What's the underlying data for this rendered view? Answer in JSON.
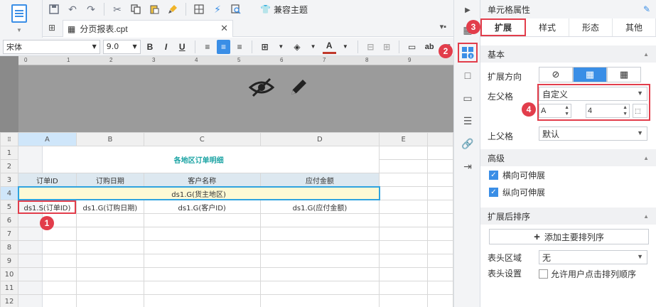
{
  "toolbar": {
    "compat_label": "兼容主题"
  },
  "tab": {
    "filename": "分页报表.cpt"
  },
  "format": {
    "font": "宋体",
    "size": "9.0",
    "bold": "B",
    "italic": "I",
    "underline": "U",
    "color_letter": "A",
    "ab": "ab"
  },
  "ruler": [
    "0",
    "1",
    "2",
    "3",
    "4",
    "5",
    "6",
    "7",
    "8",
    "9"
  ],
  "sheet": {
    "columns": [
      "A",
      "B",
      "C",
      "D",
      "E"
    ],
    "rows": [
      "1",
      "2",
      "3",
      "4",
      "5",
      "6",
      "7",
      "8",
      "9",
      "10",
      "11",
      "12"
    ],
    "title": "各地区订单明细",
    "headers": [
      "订单ID",
      "订购日期",
      "客户名称",
      "应付金额"
    ],
    "row4": "ds1.G(货主地区)",
    "row5": [
      "ds1.S(订单ID)",
      "ds1.G(订购日期)",
      "ds1.G(客户ID)",
      "ds1.G(应付金额)"
    ]
  },
  "markers": [
    "1",
    "2",
    "3",
    "4"
  ],
  "panel": {
    "title": "单元格属性",
    "tabs": [
      "扩展",
      "样式",
      "形态",
      "其他"
    ],
    "basic": "基本",
    "direction_label": "扩展方向",
    "left_parent_label": "左父格",
    "left_parent_value": "自定义",
    "left_col": "A",
    "left_row": "4",
    "top_parent_label": "上父格",
    "top_parent_value": "默认",
    "advanced": "高级",
    "h_extend": "横向可伸展",
    "v_extend": "纵向可伸展",
    "sort_section": "扩展后排序",
    "add_sort": "添加主要排列序",
    "header_area_label": "表头区域",
    "header_area_value": "无",
    "header_setting_label": "表头设置",
    "allow_sort": "允许用户点击排列顺序"
  }
}
